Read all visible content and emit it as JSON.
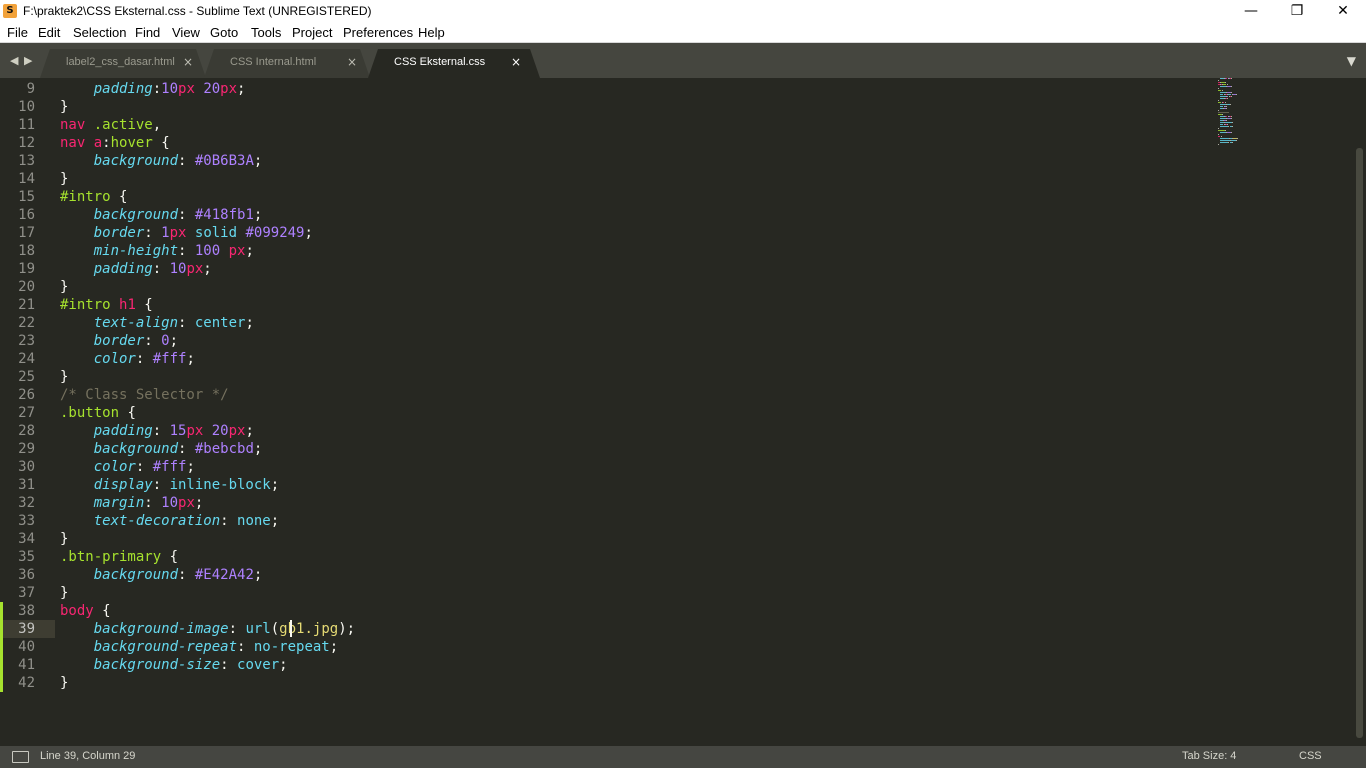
{
  "window": {
    "title": "F:\\praktek2\\CSS Eksternal.css - Sublime Text (UNREGISTERED)",
    "app_icon": "S",
    "minimize_symbol": "—",
    "maximize_symbol": "❐",
    "close_symbol": "✕"
  },
  "menu": [
    "File",
    "Edit",
    "Selection",
    "Find",
    "View",
    "Goto",
    "Tools",
    "Project",
    "Preferences",
    "Help"
  ],
  "tabs": [
    {
      "label": "label2_css_dasar.html",
      "active": false
    },
    {
      "label": "CSS Internal.html",
      "active": false
    },
    {
      "label": "CSS Eksternal.css",
      "active": true
    }
  ],
  "tab_close_symbol": "×",
  "nav_left_symbol": "◀",
  "nav_right_symbol": "▶",
  "tab_dropdown_symbol": "▼",
  "editor": {
    "current_line": 39,
    "lines": [
      {
        "n": 9,
        "tokens": [
          [
            "p",
            "    padding"
          ],
          [
            "x",
            ":"
          ],
          [
            "n",
            "10"
          ],
          [
            "u",
            "px"
          ],
          [
            "x",
            " "
          ],
          [
            "n",
            "20"
          ],
          [
            "u",
            "px"
          ],
          [
            "x",
            ";"
          ]
        ]
      },
      {
        "n": 10,
        "tokens": [
          [
            "x",
            "}"
          ]
        ]
      },
      {
        "n": 11,
        "tokens": [
          [
            "s",
            "nav"
          ],
          [
            "x",
            " "
          ],
          [
            "c",
            ".active"
          ],
          [
            "x",
            ","
          ]
        ]
      },
      {
        "n": 12,
        "tokens": [
          [
            "s",
            "nav"
          ],
          [
            "x",
            " "
          ],
          [
            "s",
            "a"
          ],
          [
            "x",
            ":"
          ],
          [
            "c",
            "hover"
          ],
          [
            "x",
            " {"
          ]
        ]
      },
      {
        "n": 13,
        "tokens": [
          [
            "p",
            "    background"
          ],
          [
            "x",
            ": "
          ],
          [
            "n",
            "#0B6B3A"
          ],
          [
            "x",
            ";"
          ]
        ]
      },
      {
        "n": 14,
        "tokens": [
          [
            "x",
            "}"
          ]
        ]
      },
      {
        "n": 15,
        "tokens": [
          [
            "c",
            "#intro"
          ],
          [
            "x",
            " {"
          ]
        ]
      },
      {
        "n": 16,
        "tokens": [
          [
            "p",
            "    background"
          ],
          [
            "x",
            ": "
          ],
          [
            "n",
            "#418fb1"
          ],
          [
            "x",
            ";"
          ]
        ]
      },
      {
        "n": 17,
        "tokens": [
          [
            "p",
            "    border"
          ],
          [
            "x",
            ": "
          ],
          [
            "n",
            "1"
          ],
          [
            "u",
            "px"
          ],
          [
            "x",
            " "
          ],
          [
            "v",
            "solid"
          ],
          [
            "x",
            " "
          ],
          [
            "n",
            "#099249"
          ],
          [
            "x",
            ";"
          ]
        ]
      },
      {
        "n": 18,
        "tokens": [
          [
            "p",
            "    min-height"
          ],
          [
            "x",
            ": "
          ],
          [
            "n",
            "100"
          ],
          [
            "x",
            " "
          ],
          [
            "u",
            "px"
          ],
          [
            "x",
            ";"
          ]
        ]
      },
      {
        "n": 19,
        "tokens": [
          [
            "p",
            "    padding"
          ],
          [
            "x",
            ": "
          ],
          [
            "n",
            "10"
          ],
          [
            "u",
            "px"
          ],
          [
            "x",
            ";"
          ]
        ]
      },
      {
        "n": 20,
        "tokens": [
          [
            "x",
            "}"
          ]
        ]
      },
      {
        "n": 21,
        "tokens": [
          [
            "c",
            "#intro"
          ],
          [
            "x",
            " "
          ],
          [
            "s",
            "h1"
          ],
          [
            "x",
            " {"
          ]
        ]
      },
      {
        "n": 22,
        "tokens": [
          [
            "p",
            "    text-align"
          ],
          [
            "x",
            ": "
          ],
          [
            "v",
            "center"
          ],
          [
            "x",
            ";"
          ]
        ]
      },
      {
        "n": 23,
        "tokens": [
          [
            "p",
            "    border"
          ],
          [
            "x",
            ": "
          ],
          [
            "n",
            "0"
          ],
          [
            "x",
            ";"
          ]
        ]
      },
      {
        "n": 24,
        "tokens": [
          [
            "p",
            "    color"
          ],
          [
            "x",
            ": "
          ],
          [
            "n",
            "#fff"
          ],
          [
            "x",
            ";"
          ]
        ]
      },
      {
        "n": 25,
        "tokens": [
          [
            "x",
            "}"
          ]
        ]
      },
      {
        "n": 26,
        "tokens": [
          [
            "m",
            "/* Class Selector */"
          ]
        ]
      },
      {
        "n": 27,
        "tokens": [
          [
            "c",
            ".button"
          ],
          [
            "x",
            " {"
          ]
        ]
      },
      {
        "n": 28,
        "tokens": [
          [
            "p",
            "    padding"
          ],
          [
            "x",
            ": "
          ],
          [
            "n",
            "15"
          ],
          [
            "u",
            "px"
          ],
          [
            "x",
            " "
          ],
          [
            "n",
            "20"
          ],
          [
            "u",
            "px"
          ],
          [
            "x",
            ";"
          ]
        ]
      },
      {
        "n": 29,
        "tokens": [
          [
            "p",
            "    background"
          ],
          [
            "x",
            ": "
          ],
          [
            "n",
            "#bebcbd"
          ],
          [
            "x",
            ";"
          ]
        ]
      },
      {
        "n": 30,
        "tokens": [
          [
            "p",
            "    color"
          ],
          [
            "x",
            ": "
          ],
          [
            "n",
            "#fff"
          ],
          [
            "x",
            ";"
          ]
        ]
      },
      {
        "n": 31,
        "tokens": [
          [
            "p",
            "    display"
          ],
          [
            "x",
            ": "
          ],
          [
            "v",
            "inline-block"
          ],
          [
            "x",
            ";"
          ]
        ]
      },
      {
        "n": 32,
        "tokens": [
          [
            "p",
            "    margin"
          ],
          [
            "x",
            ": "
          ],
          [
            "n",
            "10"
          ],
          [
            "u",
            "px"
          ],
          [
            "x",
            ";"
          ]
        ]
      },
      {
        "n": 33,
        "tokens": [
          [
            "p",
            "    text-decoration"
          ],
          [
            "x",
            ": "
          ],
          [
            "v",
            "none"
          ],
          [
            "x",
            ";"
          ]
        ]
      },
      {
        "n": 34,
        "tokens": [
          [
            "x",
            "}"
          ]
        ]
      },
      {
        "n": 35,
        "tokens": [
          [
            "c",
            ".btn-primary"
          ],
          [
            "x",
            " {"
          ]
        ]
      },
      {
        "n": 36,
        "tokens": [
          [
            "p",
            "    background"
          ],
          [
            "x",
            ": "
          ],
          [
            "n",
            "#E42A42"
          ],
          [
            "x",
            ";"
          ]
        ]
      },
      {
        "n": 37,
        "tokens": [
          [
            "x",
            "}"
          ]
        ]
      },
      {
        "n": 38,
        "tokens": [
          [
            "s",
            "body"
          ],
          [
            "x",
            " {"
          ]
        ],
        "modified": true
      },
      {
        "n": 39,
        "tokens": [
          [
            "p",
            "    background-image"
          ],
          [
            "x",
            ": "
          ],
          [
            "v",
            "url"
          ],
          [
            "x",
            "("
          ],
          [
            "t",
            "gb1.jpg"
          ],
          [
            "x",
            ");"
          ]
        ],
        "modified": true
      },
      {
        "n": 40,
        "tokens": [
          [
            "p",
            "    background-repeat"
          ],
          [
            "x",
            ": "
          ],
          [
            "v",
            "no-repeat"
          ],
          [
            "x",
            ";"
          ]
        ],
        "modified": true
      },
      {
        "n": 41,
        "tokens": [
          [
            "p",
            "    background-size"
          ],
          [
            "x",
            ": "
          ],
          [
            "v",
            "cover"
          ],
          [
            "x",
            ";"
          ]
        ],
        "modified": true
      },
      {
        "n": 42,
        "tokens": [
          [
            "x",
            "}"
          ]
        ],
        "modified": true
      }
    ]
  },
  "status": {
    "position": "Line 39, Column 29",
    "tab_size": "Tab Size: 4",
    "syntax": "CSS"
  },
  "colors": {
    "background": "#272822",
    "selector": "#f92672",
    "class": "#a6e22e",
    "property": "#66d9ef",
    "number": "#ae81ff",
    "string": "#e6db74",
    "comment": "#75715e",
    "modified_marker": "#a6e22e"
  }
}
